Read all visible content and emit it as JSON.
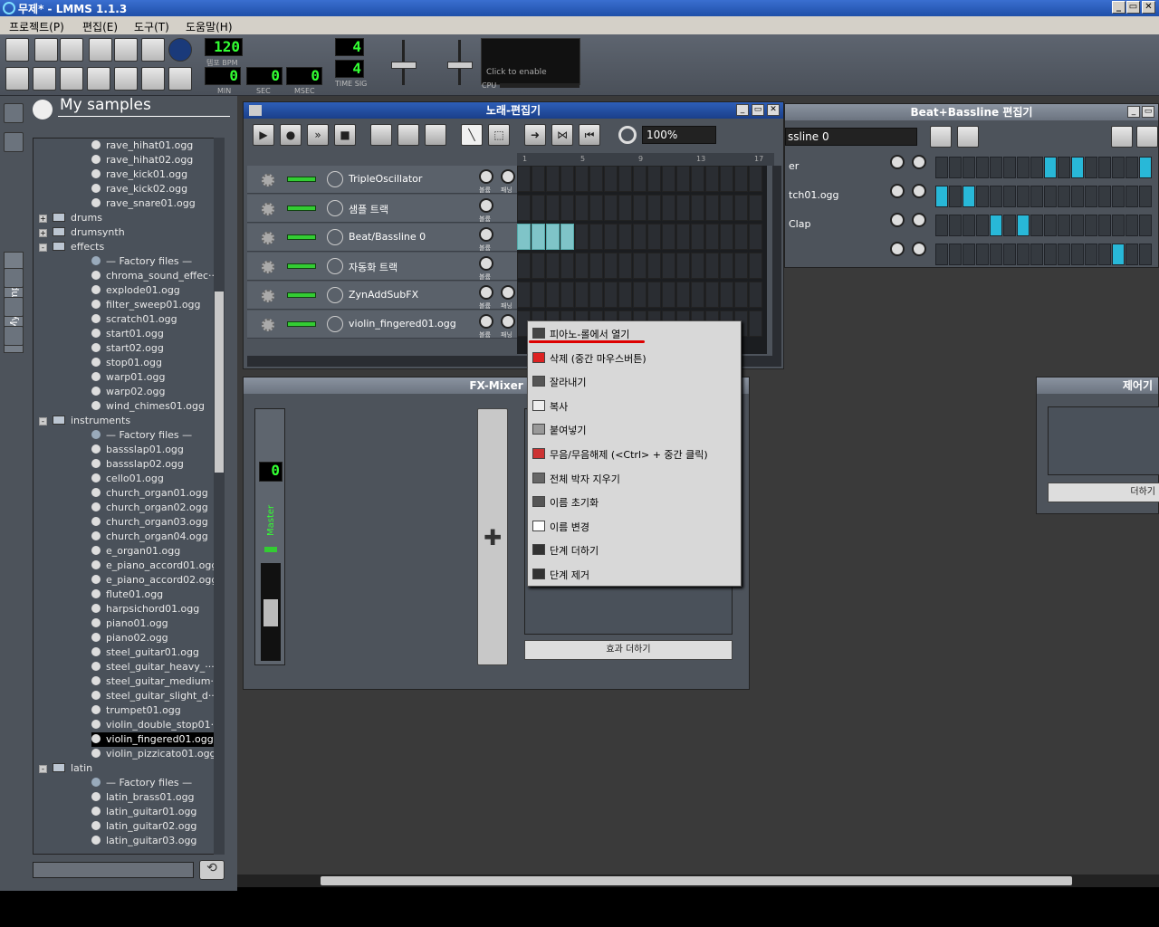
{
  "window": {
    "title": "무제* - LMMS 1.1.3",
    "min": "_",
    "restore": "▭",
    "close": "✕"
  },
  "menu": [
    "프로젝트(P)",
    "편집(E)",
    "도구(T)",
    "도움말(H)"
  ],
  "transport": {
    "tempo": "120",
    "tempo_label": "템포 BPM",
    "min": "0",
    "sec": "0",
    "msec": "0",
    "min_label": "MIN",
    "sec_label": "SEC",
    "msec_label": "MSEC",
    "timesig_num": "4",
    "timesig_den": "4",
    "timesig_label": "TIME SIG",
    "cpu_hint": "Click to enable",
    "cpu_label": "CPU"
  },
  "browser": {
    "title": "My samples",
    "tab_label": "My samples",
    "items": [
      {
        "type": "file",
        "label": "rave_hihat01.ogg"
      },
      {
        "type": "file",
        "label": "rave_hihat02.ogg"
      },
      {
        "type": "file",
        "label": "rave_kick01.ogg"
      },
      {
        "type": "file",
        "label": "rave_kick02.ogg"
      },
      {
        "type": "file",
        "label": "rave_snare01.ogg"
      },
      {
        "type": "folder",
        "label": "drums",
        "state": "+"
      },
      {
        "type": "folder",
        "label": "drumsynth",
        "state": "+"
      },
      {
        "type": "folder",
        "label": "effects",
        "state": "-"
      },
      {
        "type": "factory",
        "label": "— Factory files —"
      },
      {
        "type": "file",
        "label": "chroma_sound_effec···"
      },
      {
        "type": "file",
        "label": "explode01.ogg"
      },
      {
        "type": "file",
        "label": "filter_sweep01.ogg"
      },
      {
        "type": "file",
        "label": "scratch01.ogg"
      },
      {
        "type": "file",
        "label": "start01.ogg"
      },
      {
        "type": "file",
        "label": "start02.ogg"
      },
      {
        "type": "file",
        "label": "stop01.ogg"
      },
      {
        "type": "file",
        "label": "warp01.ogg"
      },
      {
        "type": "file",
        "label": "warp02.ogg"
      },
      {
        "type": "file",
        "label": "wind_chimes01.ogg"
      },
      {
        "type": "folder",
        "label": "instruments",
        "state": "-"
      },
      {
        "type": "factory",
        "label": "— Factory files —"
      },
      {
        "type": "file",
        "label": "bassslap01.ogg"
      },
      {
        "type": "file",
        "label": "bassslap02.ogg"
      },
      {
        "type": "file",
        "label": "cello01.ogg"
      },
      {
        "type": "file",
        "label": "church_organ01.ogg"
      },
      {
        "type": "file",
        "label": "church_organ02.ogg"
      },
      {
        "type": "file",
        "label": "church_organ03.ogg"
      },
      {
        "type": "file",
        "label": "church_organ04.ogg"
      },
      {
        "type": "file",
        "label": "e_organ01.ogg"
      },
      {
        "type": "file",
        "label": "e_piano_accord01.ogg"
      },
      {
        "type": "file",
        "label": "e_piano_accord02.ogg"
      },
      {
        "type": "file",
        "label": "flute01.ogg"
      },
      {
        "type": "file",
        "label": "harpsichord01.ogg"
      },
      {
        "type": "file",
        "label": "piano01.ogg"
      },
      {
        "type": "file",
        "label": "piano02.ogg"
      },
      {
        "type": "file",
        "label": "steel_guitar01.ogg"
      },
      {
        "type": "file",
        "label": "steel_guitar_heavy_···"
      },
      {
        "type": "file",
        "label": "steel_guitar_medium···"
      },
      {
        "type": "file",
        "label": "steel_guitar_slight_d···"
      },
      {
        "type": "file",
        "label": "trumpet01.ogg"
      },
      {
        "type": "file",
        "label": "violin_double_stop01···"
      },
      {
        "type": "file",
        "label": "violin_fingered01.ogg",
        "selected": true
      },
      {
        "type": "file",
        "label": "violin_pizzicato01.ogg"
      },
      {
        "type": "folder",
        "label": "latin",
        "state": "-"
      },
      {
        "type": "factory",
        "label": "— Factory files —"
      },
      {
        "type": "file",
        "label": "latin_brass01.ogg"
      },
      {
        "type": "file",
        "label": "latin_guitar01.ogg"
      },
      {
        "type": "file",
        "label": "latin_guitar02.ogg"
      },
      {
        "type": "file",
        "label": "latin_guitar03.ogg"
      }
    ]
  },
  "song_editor": {
    "title": "노래-편집기",
    "zoom": "100%",
    "bar_numbers": [
      "1",
      "5",
      "9",
      "13",
      "17"
    ],
    "tracks": [
      {
        "name": "TripleOscillator",
        "has_pan": true
      },
      {
        "name": "샘플 트랙",
        "has_pan": false
      },
      {
        "name": "Beat/Bassline 0",
        "has_pan": false
      },
      {
        "name": "자동화 트랙",
        "has_pan": false
      },
      {
        "name": "ZynAddSubFX",
        "has_pan": true
      },
      {
        "name": "violin_fingered01.ogg",
        "has_pan": true
      }
    ],
    "knob_label_vol": "볼륨",
    "knob_label_pan": "패닝"
  },
  "bb_editor": {
    "title": "Beat+Bassline 편집기",
    "selector": "ssline 0",
    "rows": [
      {
        "label": "er",
        "steps": [
          0,
          0,
          0,
          0,
          0,
          0,
          0,
          0,
          1,
          0,
          1,
          0,
          0,
          0,
          0,
          1
        ]
      },
      {
        "label": "tch01.ogg",
        "steps": [
          1,
          0,
          1,
          0,
          0,
          0,
          0,
          0,
          0,
          0,
          0,
          0,
          0,
          0,
          0,
          0
        ]
      },
      {
        "label": "Clap",
        "steps": [
          0,
          0,
          0,
          0,
          1,
          0,
          1,
          0,
          0,
          0,
          0,
          0,
          0,
          0,
          0,
          0
        ]
      },
      {
        "label": "",
        "steps": [
          0,
          0,
          0,
          0,
          0,
          0,
          0,
          0,
          0,
          0,
          0,
          0,
          0,
          1,
          0,
          0
        ]
      }
    ]
  },
  "fx_mixer": {
    "title": "FX-Mixer",
    "channel_number": "0",
    "master_label": "Master",
    "add_effect": "효과 더하기",
    "plus": "✚"
  },
  "controller": {
    "title": "제어기 ",
    "add_label": "더하기"
  },
  "context_menu": {
    "items": [
      {
        "label": "피아노-롤에서 열기",
        "icon": "piano-icon"
      },
      {
        "label": "삭제 (중간 마우스버튼)",
        "icon": "delete-icon"
      },
      {
        "label": "잘라내기",
        "icon": "scissors-icon"
      },
      {
        "label": "복사",
        "icon": "copy-icon"
      },
      {
        "label": "붙여넣기",
        "icon": "paste-icon"
      },
      {
        "label": "무음/무음해제 (<Ctrl> + 중간 클릭)",
        "icon": "mute-icon"
      },
      {
        "label": "전체 박자 지우기",
        "icon": "eraser-icon"
      },
      {
        "label": "이름 초기화",
        "icon": "reset-icon"
      },
      {
        "label": "이름 변경",
        "icon": "rename-icon"
      },
      {
        "label": "단계 더하기",
        "icon": "add-step-icon"
      },
      {
        "label": "단계 제거",
        "icon": "remove-step-icon"
      }
    ]
  }
}
